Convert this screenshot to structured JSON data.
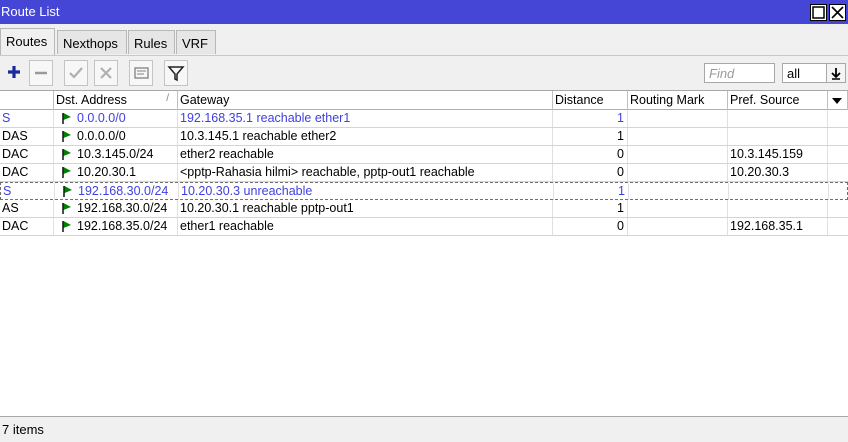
{
  "window": {
    "title": "Route List"
  },
  "tabs": [
    {
      "label": "Routes",
      "active": true
    },
    {
      "label": "Nexthops",
      "active": false
    },
    {
      "label": "Rules",
      "active": false
    },
    {
      "label": "VRF",
      "active": false
    }
  ],
  "toolbar": {
    "find_placeholder": "Find",
    "filter_value": "all"
  },
  "table": {
    "columns": [
      "",
      "Dst. Address",
      "Gateway",
      "Distance",
      "Routing Mark",
      "Pref. Source"
    ],
    "sort_indicator": "/",
    "rows": [
      {
        "flags": "S",
        "dst": "0.0.0.0/0",
        "gateway": "192.168.35.1 reachable ether1",
        "distance": "1",
        "mark": "",
        "pref": "",
        "style": "blue"
      },
      {
        "flags": "DAS",
        "dst": "0.0.0.0/0",
        "gateway": "10.3.145.1 reachable ether2",
        "distance": "1",
        "mark": "",
        "pref": "",
        "style": "normal"
      },
      {
        "flags": "DAC",
        "dst": "10.3.145.0/24",
        "gateway": "ether2 reachable",
        "distance": "0",
        "mark": "",
        "pref": "10.3.145.159",
        "style": "normal"
      },
      {
        "flags": "DAC",
        "dst": "10.20.30.1",
        "gateway": "<pptp-Rahasia hilmi> reachable, pptp-out1 reachable",
        "distance": "0",
        "mark": "",
        "pref": "10.20.30.3",
        "style": "normal"
      },
      {
        "flags": "S",
        "dst": "192.168.30.0/24",
        "gateway": "10.20.30.3 unreachable",
        "distance": "1",
        "mark": "",
        "pref": "",
        "style": "blue-selected"
      },
      {
        "flags": "AS",
        "dst": "192.168.30.0/24",
        "gateway": "10.20.30.1 reachable pptp-out1",
        "distance": "1",
        "mark": "",
        "pref": "",
        "style": "normal"
      },
      {
        "flags": "DAC",
        "dst": "192.168.35.0/24",
        "gateway": "ether1 reachable",
        "distance": "0",
        "mark": "",
        "pref": "192.168.35.1",
        "style": "normal"
      }
    ]
  },
  "status": {
    "text": "7 items"
  },
  "colors": {
    "titlebar": "#4646d6",
    "static_route_text": "#4040e0",
    "flag_green": "#008000"
  }
}
